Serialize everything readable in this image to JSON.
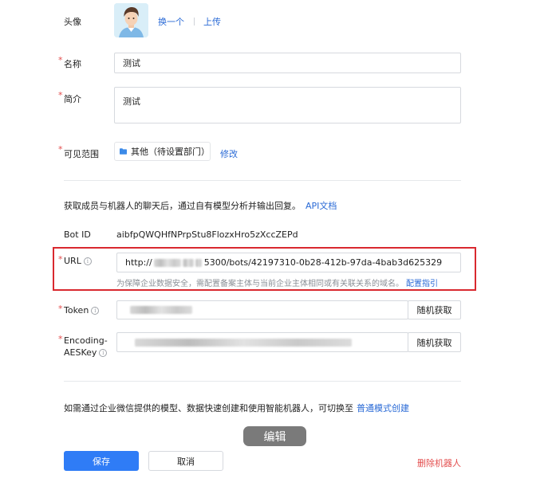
{
  "avatar": {
    "label": "头像",
    "change": "换一个",
    "upload": "上传"
  },
  "name": {
    "label": "名称",
    "value": "测试"
  },
  "intro": {
    "label": "简介",
    "value": "测试"
  },
  "visibility": {
    "label": "可见范围",
    "scope": "其他（待设置部门）",
    "edit": "修改"
  },
  "api": {
    "desc": "获取成员与机器人的聊天后，通过自有模型分析并输出回复。",
    "doc_link": "API文档"
  },
  "bot": {
    "label": "Bot ID",
    "value": "aibfpQWQHfNPrpStu8FlozxHro5zXccZEPd"
  },
  "url": {
    "label": "URL",
    "value_prefix": "http://",
    "value_suffix": "5300/bots/42197310-0b28-412b-97da-4bab3d625329",
    "hint": "为保障企业数据安全，需配置备案主体与当前企业主体相同或有关联关系的域名。",
    "hint_link": "配置指引"
  },
  "token": {
    "label": "Token",
    "random": "随机获取"
  },
  "aes": {
    "label_line1": "Encoding-",
    "label_line2": "AESKey",
    "random": "随机获取"
  },
  "footer": {
    "desc": "如需通过企业微信提供的模型、数据快速创建和使用智能机器人，可切换至",
    "switch_link": "普通模式创建"
  },
  "overlay": {
    "edit_tag": "编辑"
  },
  "actions": {
    "save": "保存",
    "cancel": "取消",
    "delete": "删除机器人"
  },
  "colors": {
    "accent": "#2a6ad6",
    "primary_button": "#2f7cf6",
    "danger": "#e34d4d",
    "highlight_box": "#d9292f"
  }
}
